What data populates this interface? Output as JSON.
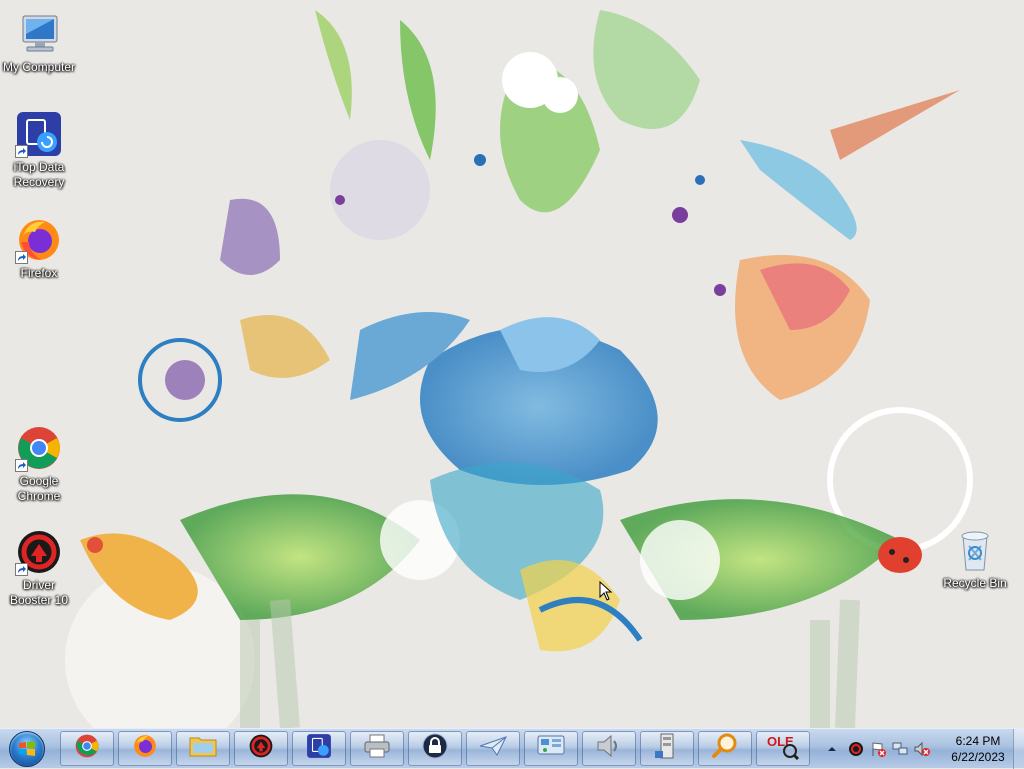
{
  "desktop": {
    "icons": [
      {
        "label": "My Computer",
        "icon": "computer-icon"
      },
      {
        "label": "iTop Data Recovery",
        "icon": "itop-data-recovery-icon"
      },
      {
        "label": "Firefox",
        "icon": "firefox-icon"
      },
      {
        "label": "Google Chrome",
        "icon": "chrome-icon"
      },
      {
        "label": "Driver Booster 10",
        "icon": "driver-booster-icon"
      },
      {
        "label": "Recycle Bin",
        "icon": "recycle-bin-icon"
      }
    ]
  },
  "taskbar": {
    "start": "start-orb",
    "pinned": [
      "chrome-icon",
      "firefox-icon",
      "windows-explorer-icon",
      "driver-booster-icon",
      "itop-data-recovery-icon",
      "printer-icon",
      "lock-icon",
      "paper-plane-icon",
      "network-settings-icon",
      "speaker-icon",
      "file-cabinet-icon",
      "magnifier-icon",
      "ole-tool-icon"
    ]
  },
  "tray": {
    "icons": [
      "show-hidden-icons-arrow",
      "driver-booster-tray-icon",
      "action-center-flag-icon",
      "network-icon",
      "volume-muted-icon"
    ],
    "time": "6:24 PM",
    "date": "6/22/2023"
  },
  "colors": {
    "taskbar": "#a9c1e0",
    "desktop_bg": "#e9e8e4"
  }
}
